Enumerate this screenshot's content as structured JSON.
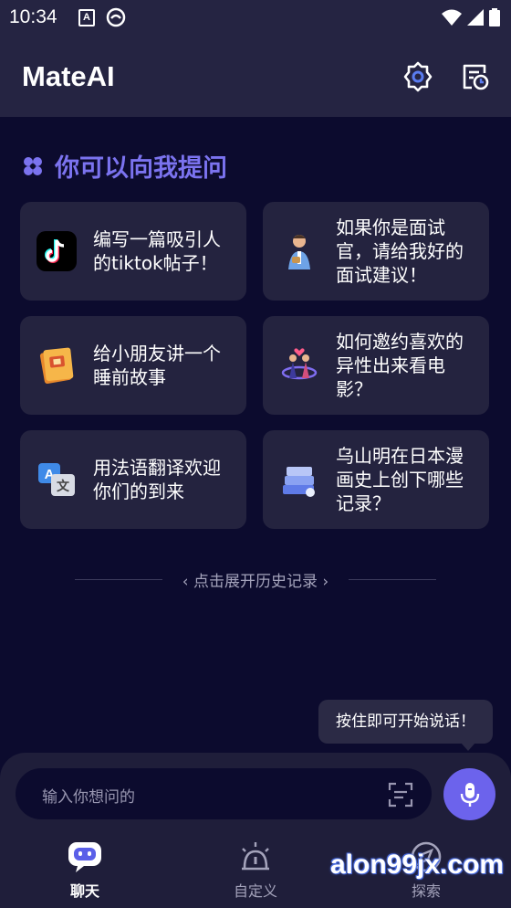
{
  "status_bar": {
    "time": "10:34",
    "notif_a": "A"
  },
  "header": {
    "title": "MateAI",
    "settings_icon": "gear-icon",
    "history_icon": "calendar-clock-icon"
  },
  "prompts": {
    "title": "你可以向我提问",
    "cards": [
      {
        "lines": [
          "编写一篇吸引人",
          "的tiktok帖子！"
        ],
        "icon": "tiktok-logo-icon"
      },
      {
        "lines": [
          "如果你是面试",
          "官，请给我好的",
          "面试建议！"
        ],
        "icon": "interviewer-icon"
      },
      {
        "lines": [
          "给小朋友讲一个",
          "睡前故事"
        ],
        "icon": "storybook-icon"
      },
      {
        "lines": [
          "如何邀约喜欢的",
          "异性出来看电",
          "影？"
        ],
        "icon": "couple-icon"
      },
      {
        "lines": [
          "用法语翻译欢迎",
          "你们的到来"
        ],
        "icon": "translate-icon"
      },
      {
        "lines": [
          "乌山明在日本漫",
          "画史上创下哪些",
          "记录？"
        ],
        "icon": "books-icon"
      }
    ]
  },
  "history": {
    "label": "‹ 点击展开历史记录 ›"
  },
  "tooltip": {
    "text": "按住即可开始说话！"
  },
  "input": {
    "placeholder": "输入你想问的"
  },
  "nav": {
    "chat": "聊天",
    "custom": "自定义",
    "explore": "探索"
  },
  "watermark": "alon99jx.com",
  "colors": {
    "accent": "#6c63ec",
    "title_accent": "#7b73ef",
    "background": "#0c0b2e",
    "card": "#24233f"
  }
}
